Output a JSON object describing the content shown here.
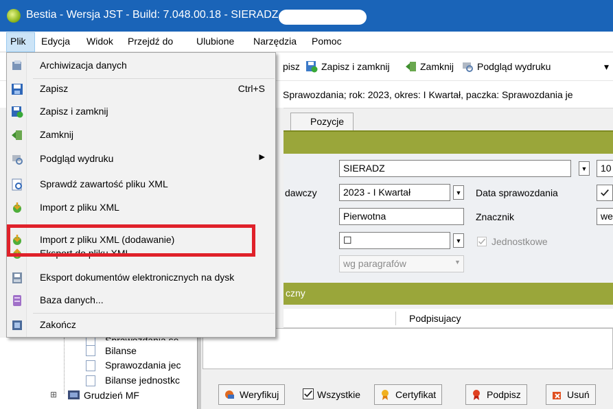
{
  "window": {
    "title": "Bestia - Wersja JST - Build: 7.048.00.18 - SIERADZ"
  },
  "menubar": {
    "items": [
      "Plik",
      "Edycja",
      "Widok",
      "Przejdź do",
      "Ulubione",
      "Narzędzia",
      "Pomoc"
    ]
  },
  "toolbar": {
    "zapisz_partial": "pisz",
    "zapisz_zamknij": "Zapisz i zamknij",
    "zamknij": "Zamknij",
    "podglad": "Podgląd wydruku",
    "more_arrow": "▾"
  },
  "status": {
    "text": "Sprawozdania; rok: 2023, okres: I Kwartał, paczka: Sprawozdania je"
  },
  "tabs": {
    "pozycje": "Pozycje"
  },
  "form": {
    "jednostka_value": "SIERADZ",
    "right_value_1": "10",
    "okres_label_partial": "dawczy",
    "okres_value": "2023 - I Kwartał",
    "data_spr_label": "Data sprawozdania",
    "data_spr_checked": true,
    "rodzaj_value": "Pierwotna",
    "znacznik_label": "Znacznik",
    "znacznik_value": "we",
    "blank_select_checkbox": "☐",
    "jednostkowe_label": "Jednostkowe",
    "jednostkowe_checked": true,
    "paragraf_value": "wg paragrafów"
  },
  "section2": {
    "header_partial": "czny"
  },
  "grid": {
    "col_podpisujacy": "Podpisujacy"
  },
  "buttons": {
    "weryfikuj": "Weryfikuj",
    "wszystkie": "Wszystkie",
    "wszystkie_checked": true,
    "certyfikat": "Certyfikat",
    "podpisz": "Podpisz",
    "usun": "Usuń"
  },
  "tree": {
    "items": [
      {
        "label": "Sprawozdania se",
        "icon": "document-icon"
      },
      {
        "label": "Bilanse",
        "icon": "document-icon"
      },
      {
        "label": "Sprawozdania jec",
        "icon": "document-icon"
      },
      {
        "label": "Bilanse jednostkc",
        "icon": "document-icon"
      },
      {
        "label": "Grudzień MF",
        "icon": "folder-icon"
      }
    ],
    "expander": "⊞"
  },
  "plik_menu": {
    "items": [
      {
        "label": "Archiwizacja danych",
        "icon": "archive-icon",
        "shortcut": ""
      },
      {
        "label": "Zapisz",
        "icon": "save-icon",
        "shortcut": "Ctrl+S"
      },
      {
        "label": "Zapisz i zamknij",
        "icon": "save-close-icon",
        "shortcut": ""
      },
      {
        "label": "Zamknij",
        "icon": "close-door-icon",
        "shortcut": ""
      },
      {
        "label": "Podgląd wydruku",
        "icon": "print-preview-icon",
        "shortcut": "",
        "submenu_arrow": "▶"
      },
      {
        "label": "Sprawdź zawartość pliku XML",
        "icon": "check-xml-icon",
        "shortcut": ""
      },
      {
        "label": "Import z pliku XML",
        "icon": "import-xml-icon",
        "shortcut": ""
      },
      {
        "label": "Import z pliku XML (dodawanie)",
        "icon": "import-xml-add-icon",
        "shortcut": ""
      },
      {
        "label": "Eksport do pliku XML",
        "icon": "export-xml-icon",
        "shortcut": ""
      },
      {
        "label": "Eksport dokumentów elektronicznych na dysk",
        "icon": "export-disk-icon",
        "shortcut": ""
      },
      {
        "label": "Baza danych...",
        "icon": "database-icon",
        "shortcut": ""
      },
      {
        "label": "Zakończ",
        "icon": "exit-icon",
        "shortcut": ""
      }
    ]
  },
  "colors": {
    "titlebar": "#1a64b8",
    "olive_header": "#9aa63a",
    "highlight": "#e0212a"
  }
}
